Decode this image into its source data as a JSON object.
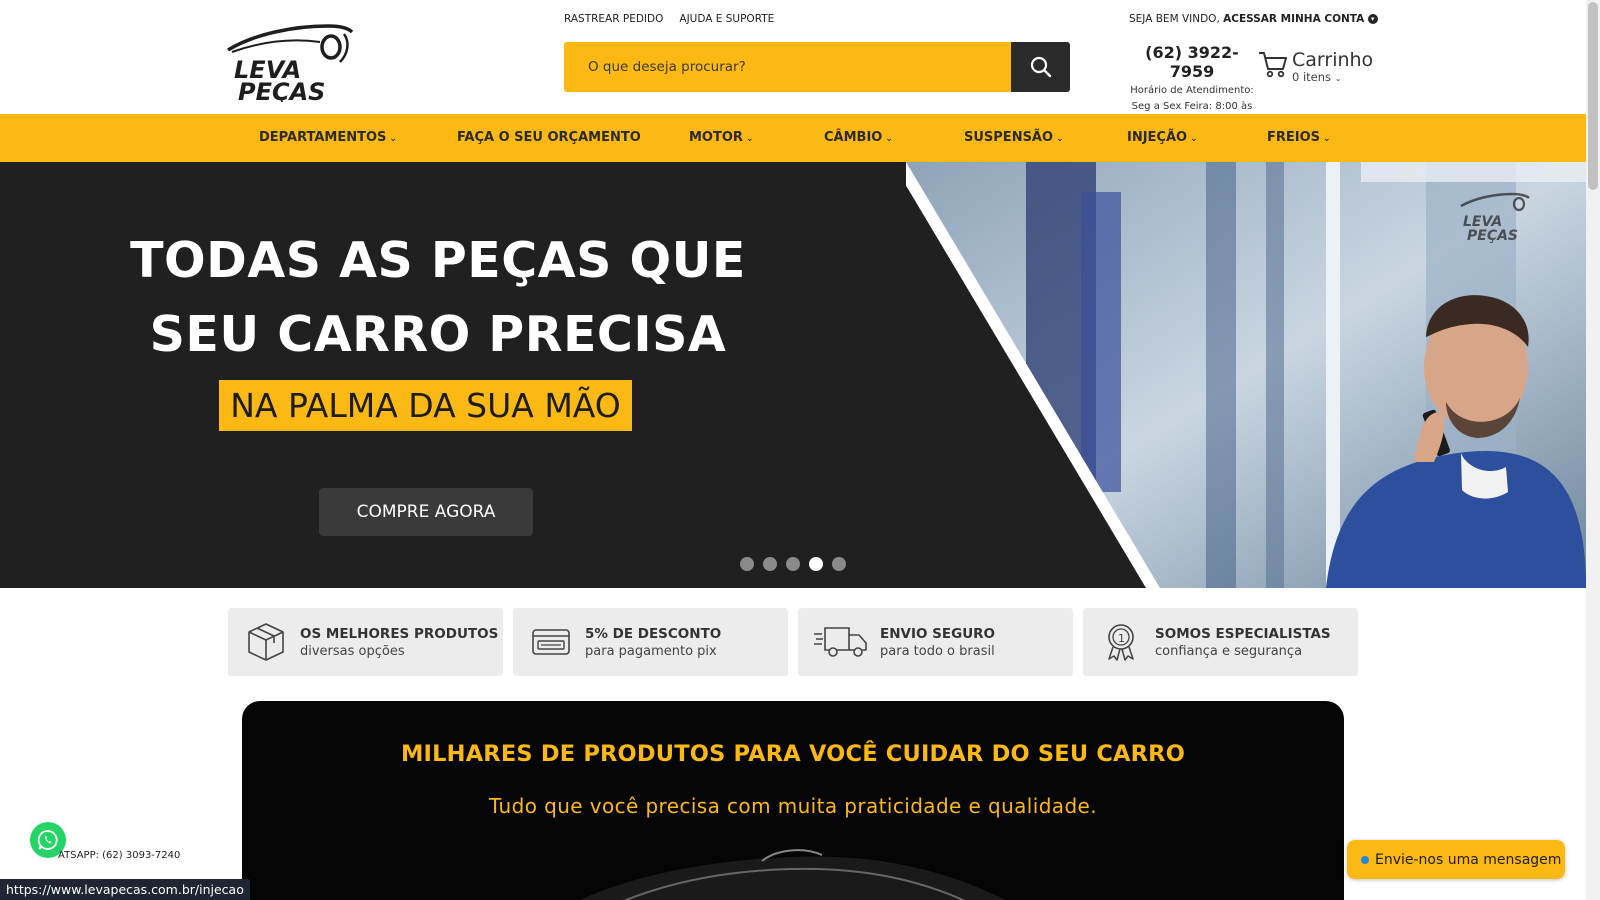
{
  "header": {
    "logo_text": "LEVA PEÇAS",
    "top_links": [
      "RASTREAR PEDIDO",
      "AJUDA E SUPORTE"
    ],
    "search_placeholder": "O que deseja procurar?",
    "welcome_prefix": "SEJA BEM VINDO,",
    "account_link": "ACESSAR MINHA CONTA",
    "phone": "(62) 3922-7959",
    "hours_line1": "Horário de Atendimento:",
    "hours_line2": "Seg a Sex Feira: 8:00 às",
    "cart_label": "Carrinho",
    "cart_count": "0 itens"
  },
  "nav": {
    "items": [
      {
        "label": "DEPARTAMENTOS",
        "chevron": true
      },
      {
        "label": "FAÇA O SEU ORÇAMENTO",
        "chevron": false
      },
      {
        "label": "MOTOR",
        "chevron": true
      },
      {
        "label": "CÂMBIO",
        "chevron": true
      },
      {
        "label": "SUSPENSÃO",
        "chevron": true
      },
      {
        "label": "INJEÇÃO",
        "chevron": true
      },
      {
        "label": "FREIOS",
        "chevron": true
      }
    ]
  },
  "hero": {
    "title_line1": "TODAS AS PEÇAS QUE",
    "title_line2": "SEU CARRO PRECISA",
    "tagline": "NA PALMA DA SUA MÃO",
    "cta": "COMPRE AGORA",
    "slides_total": 5,
    "active_slide": 4,
    "watermark_logo": "LEVA PEÇAS"
  },
  "features": [
    {
      "title": "OS MELHORES PRODUTOS",
      "subtitle": "diversas opções",
      "icon": "box-icon"
    },
    {
      "title": "5% DE DESCONTO",
      "subtitle": "para pagamento pix",
      "icon": "card-icon"
    },
    {
      "title": "ENVIO SEGURO",
      "subtitle": "para todo o brasil",
      "icon": "truck-icon"
    },
    {
      "title": "SOMOS ESPECIALISTAS",
      "subtitle": "confiança e segurança",
      "icon": "medal-icon"
    }
  ],
  "promo": {
    "title": "MILHARES DE PRODUTOS PARA VOCÊ CUIDAR DO SEU CARRO",
    "subtitle": "Tudo que você precisa com muita praticidade e qualidade."
  },
  "whatsapp": {
    "text": "ATSAPP: (62) 3093-7240"
  },
  "status_url": "https://www.levapecas.com.br/injecao",
  "chat": {
    "label": "Envie-nos uma mensagem"
  },
  "colors": {
    "accent": "#fcb813",
    "dark": "#202020",
    "feature_bg": "#ececec"
  }
}
